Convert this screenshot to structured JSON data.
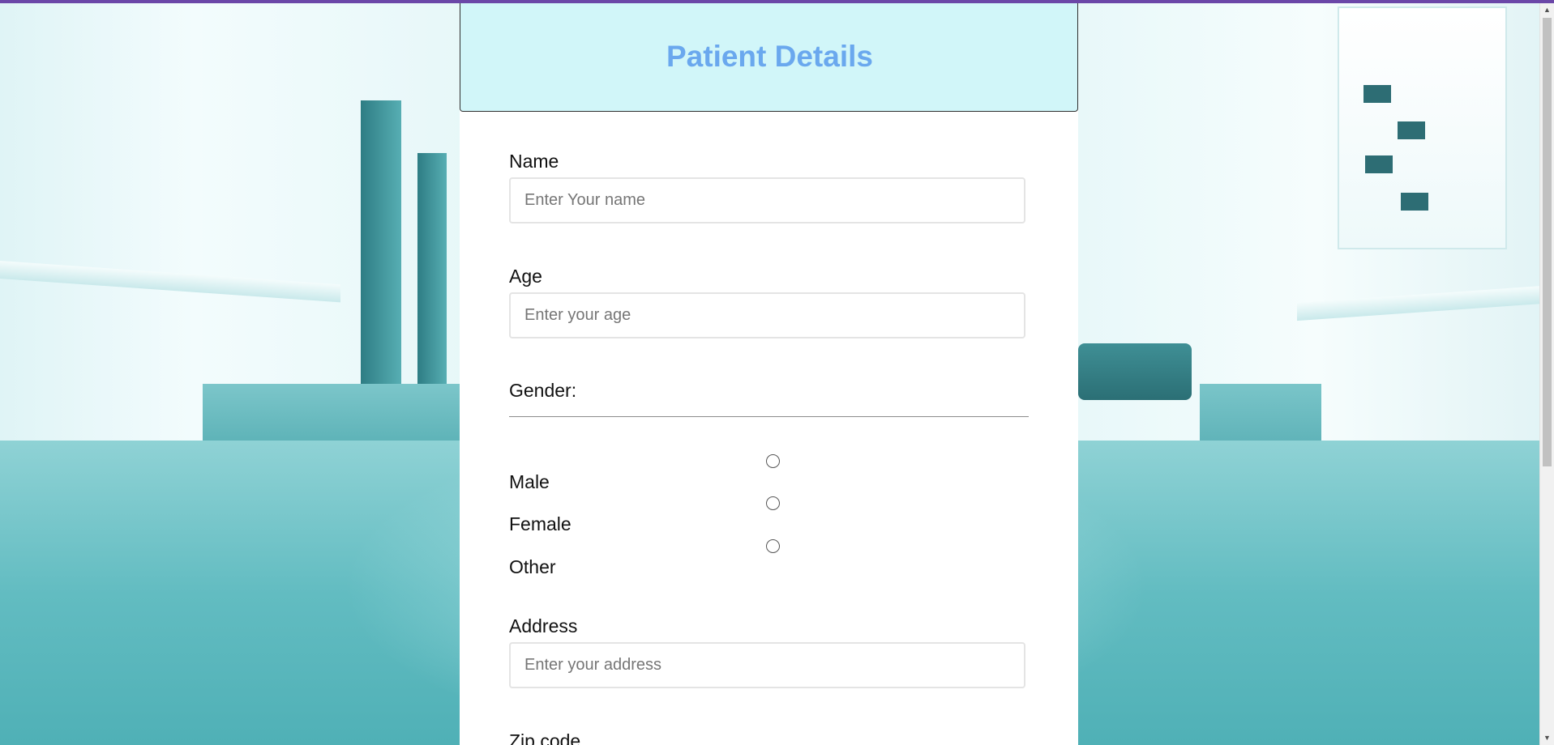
{
  "theme": {
    "accent": "#6b47a8",
    "header_bg": "#d1f6f9",
    "title_color": "#6aa8ee"
  },
  "form": {
    "title": "Patient Details",
    "name": {
      "label": "Name",
      "placeholder": "Enter Your name",
      "value": ""
    },
    "age": {
      "label": "Age",
      "placeholder": "Enter your age",
      "value": ""
    },
    "gender": {
      "label": "Gender:",
      "options": [
        {
          "label": "Male",
          "selected": false
        },
        {
          "label": "Female",
          "selected": false
        },
        {
          "label": "Other",
          "selected": false
        }
      ]
    },
    "address": {
      "label": "Address",
      "placeholder": "Enter your address",
      "value": ""
    },
    "zip": {
      "label": "Zip code"
    }
  },
  "icons": {
    "scroll_up": "scroll-up-arrow-icon",
    "scroll_down": "scroll-down-arrow-icon"
  }
}
